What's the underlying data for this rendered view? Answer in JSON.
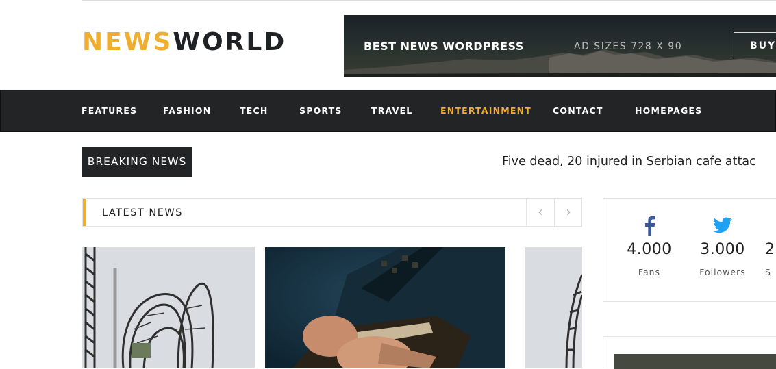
{
  "logo": {
    "part1": "NEWS",
    "part2": "WORLD"
  },
  "ad": {
    "title": "BEST NEWS WORDPRESS",
    "sizes": "AD SIZES 728 X 90",
    "button": "BUY"
  },
  "nav": {
    "items": [
      {
        "label": "FEATURES"
      },
      {
        "label": "FASHION"
      },
      {
        "label": "TECH"
      },
      {
        "label": "SPORTS"
      },
      {
        "label": "TRAVEL"
      },
      {
        "label": "ENTERTAINMENT",
        "active": true
      },
      {
        "label": "CONTACT"
      },
      {
        "label": "HOMEPAGES"
      }
    ]
  },
  "breaking": {
    "label": "BREAKING NEWS",
    "headline": "Five dead, 20 injured in Serbian cafe attac"
  },
  "latest": {
    "title": "LATEST NEWS",
    "prev_icon": "‹",
    "next_icon": "›"
  },
  "social": [
    {
      "icon": "facebook-icon",
      "count": "4.000",
      "label": "Fans"
    },
    {
      "icon": "twitter-icon",
      "count": "3.000",
      "label": "Followers"
    },
    {
      "icon": "social-icon",
      "count": "2",
      "label": "S"
    }
  ],
  "colors": {
    "accent": "#f0ae2e",
    "dark": "#222426",
    "facebook": "#3b5998",
    "twitter": "#1da1f2"
  }
}
